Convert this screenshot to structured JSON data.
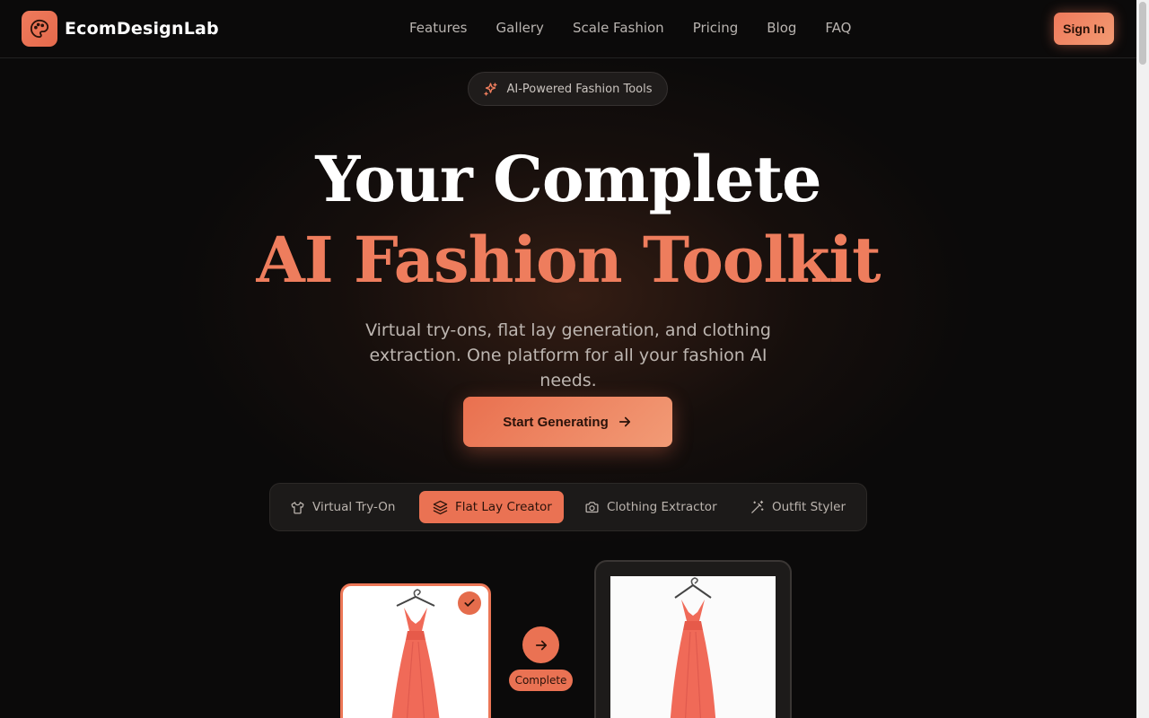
{
  "brand": {
    "name": "EcomDesignLab",
    "icon": "palette-icon",
    "accent": "#ea7253"
  },
  "nav": {
    "links": [
      "Features",
      "Gallery",
      "Scale Fashion",
      "Pricing",
      "Blog",
      "FAQ"
    ],
    "signin_label": "Sign In"
  },
  "hero": {
    "badge": "AI-Powered Fashion Tools",
    "badge_icon": "sparkles-icon",
    "title_line1": "Your Complete",
    "title_line2": "AI Fashion Toolkit",
    "subtitle": "Virtual try-ons, flat lay generation, and clothing extraction. One platform for all your fashion AI needs.",
    "cta_label": "Start Generating",
    "cta_icon": "arrow-right-icon"
  },
  "tabs": [
    {
      "label": "Virtual Try-On",
      "icon": "shirt-icon",
      "active": false
    },
    {
      "label": "Flat Lay Creator",
      "icon": "layers-icon",
      "active": true
    },
    {
      "label": "Clothing Extractor",
      "icon": "camera-icon",
      "active": false
    },
    {
      "label": "Outfit Styler",
      "icon": "magic-wand-icon",
      "active": false
    }
  ],
  "demo": {
    "status_label": "Complete",
    "dress_color": "#f06a58"
  }
}
